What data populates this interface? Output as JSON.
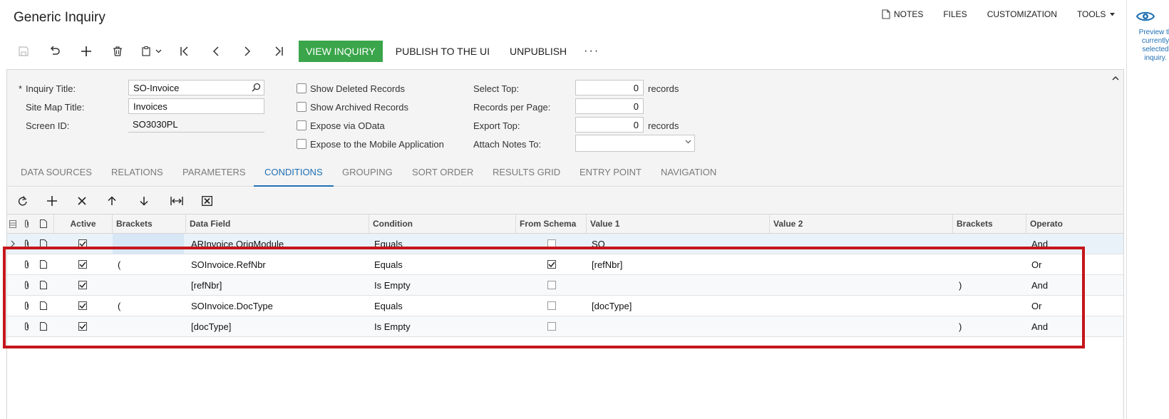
{
  "page": {
    "title": "Generic Inquiry"
  },
  "top_links": {
    "notes": "NOTES",
    "files": "FILES",
    "customization": "CUSTOMIZATION",
    "tools": "TOOLS"
  },
  "right_panel": {
    "preview_text": "Preview th currently selected inquiry."
  },
  "toolbar": {
    "icons": [
      "save-icon",
      "undo-icon",
      "add-icon",
      "delete-icon",
      "copy-paste-icon",
      "first-record-icon",
      "previous-record-icon",
      "next-record-icon",
      "last-record-icon"
    ],
    "view_inquiry": "VIEW INQUIRY",
    "publish": "PUBLISH TO THE UI",
    "unpublish": "UNPUBLISH",
    "more": "···"
  },
  "form": {
    "required_mark": "*",
    "inquiry_title_label": "Inquiry Title:",
    "inquiry_title_value": "SO-Invoice",
    "site_map_title_label": "Site Map Title:",
    "site_map_title_value": "Invoices",
    "screen_id_label": "Screen ID:",
    "screen_id_value": "SO3030PL",
    "show_deleted": "Show Deleted Records",
    "show_archived": "Show Archived Records",
    "expose_odata": "Expose via OData",
    "expose_mobile": "Expose to the Mobile Application",
    "select_top_label": "Select Top:",
    "select_top_value": "0",
    "records_per_page_label": "Records per Page:",
    "records_per_page_value": "0",
    "export_top_label": "Export Top:",
    "export_top_value": "0",
    "records_suffix": "records",
    "attach_notes_label": "Attach Notes To:",
    "attach_notes_value": ""
  },
  "tabs": [
    "DATA SOURCES",
    "RELATIONS",
    "PARAMETERS",
    "CONDITIONS",
    "GROUPING",
    "SORT ORDER",
    "RESULTS GRID",
    "ENTRY POINT",
    "NAVIGATION"
  ],
  "active_tab": "CONDITIONS",
  "grid_toolbar": {
    "icons": [
      "refresh-icon",
      "add-row-icon",
      "delete-row-icon",
      "move-up-icon",
      "move-down-icon",
      "fit-columns-icon",
      "export-excel-icon"
    ]
  },
  "grid": {
    "columns": {
      "active": "Active",
      "brackets_open": "Brackets",
      "data_field": "Data Field",
      "condition": "Condition",
      "from_schema": "From Schema",
      "value1": "Value 1",
      "value2": "Value 2",
      "brackets_close": "Brackets",
      "operator": "Operato"
    },
    "rows": [
      {
        "active": true,
        "open": "",
        "field": "ARInvoice.OrigModule",
        "condition": "Equals",
        "from_schema": false,
        "value1": "SO",
        "value2": "",
        "close": "",
        "operator": "And"
      },
      {
        "active": true,
        "open": "(",
        "field": "SOInvoice.RefNbr",
        "condition": "Equals",
        "from_schema": true,
        "value1": "[refNbr]",
        "value2": "",
        "close": "",
        "operator": "Or"
      },
      {
        "active": true,
        "open": "",
        "field": "[refNbr]",
        "condition": "Is Empty",
        "from_schema": false,
        "value1": "",
        "value2": "",
        "close": ")",
        "operator": "And"
      },
      {
        "active": true,
        "open": "(",
        "field": "SOInvoice.DocType",
        "condition": "Equals",
        "from_schema": false,
        "value1": "[docType]",
        "value2": "",
        "close": "",
        "operator": "Or"
      },
      {
        "active": true,
        "open": "",
        "field": "[docType]",
        "condition": "Is Empty",
        "from_schema": false,
        "value1": "",
        "value2": "",
        "close": ")",
        "operator": "And"
      }
    ]
  },
  "colors": {
    "accent": "#1e6fb4",
    "green_button": "#3aa54a",
    "highlight_border": "#c4161c"
  }
}
